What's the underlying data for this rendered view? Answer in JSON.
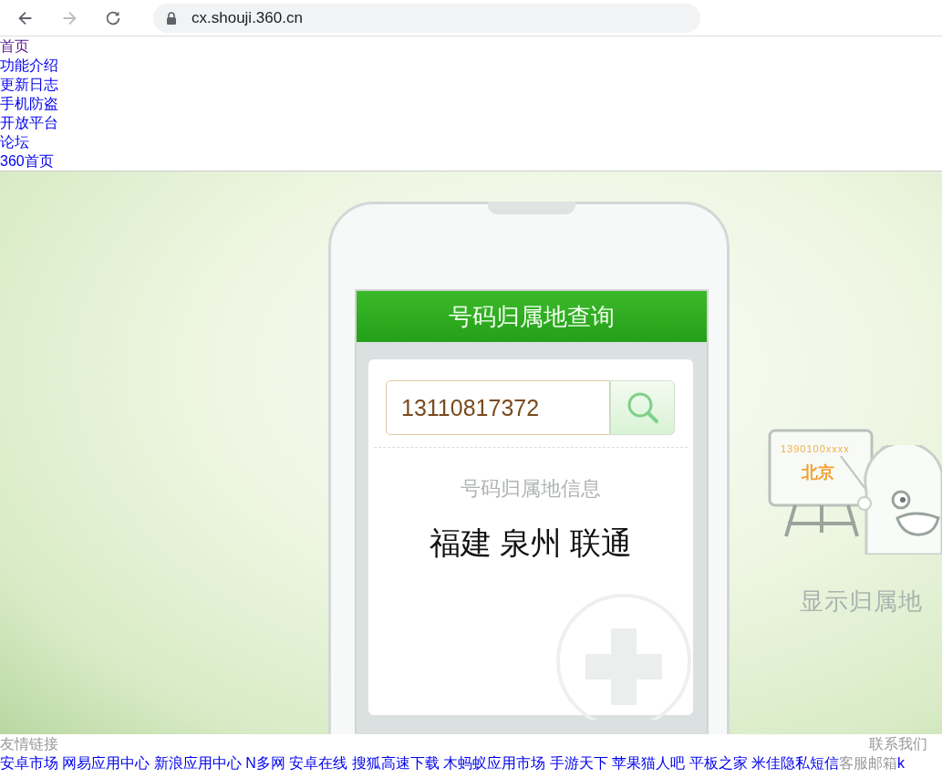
{
  "browser": {
    "url": "cx.shouji.360.cn",
    "buttons": [
      {
        "kind": "back",
        "disabled": false
      },
      {
        "kind": "forward",
        "disabled": true
      },
      {
        "kind": "reload",
        "disabled": false
      }
    ]
  },
  "nav_links": [
    {
      "label": "首页",
      "visited": true
    },
    {
      "label": "功能介绍",
      "visited": false
    },
    {
      "label": "更新日志",
      "visited": false
    },
    {
      "label": "手机防盗",
      "visited": false
    },
    {
      "label": "开放平台",
      "visited": false
    },
    {
      "label": "论坛",
      "visited": false
    },
    {
      "label": "360首页",
      "visited": false
    }
  ],
  "lookup": {
    "title": "号码归属地查询",
    "input_value": "13110817372",
    "info_label": "号码归属地信息",
    "result": "福建 泉州 联通"
  },
  "promo": {
    "board_number": "1390100xxxx",
    "board_city": "北京",
    "caption": "显示归属地"
  },
  "footer": {
    "friends_label": "友情链接",
    "contact_label": "联系我们",
    "links": [
      {
        "label": "安卓市场",
        "kind": "link"
      },
      {
        "label": "网易应用中心",
        "kind": "link"
      },
      {
        "label": "新浪应用中心",
        "kind": "link"
      },
      {
        "label": "N多网",
        "kind": "link"
      },
      {
        "label": "安卓在线",
        "kind": "link"
      },
      {
        "label": "搜狐高速下载",
        "kind": "link"
      },
      {
        "label": "木蚂蚁应用市场",
        "kind": "link"
      },
      {
        "label": "手游天下",
        "kind": "link"
      },
      {
        "label": "苹果猫人吧",
        "kind": "link"
      },
      {
        "label": "平板之家",
        "kind": "link"
      },
      {
        "label": "米佳隐私短信",
        "kind": "link"
      },
      {
        "label": "客服邮箱",
        "kind": "text"
      },
      {
        "label": "k",
        "kind": "link"
      }
    ]
  }
}
